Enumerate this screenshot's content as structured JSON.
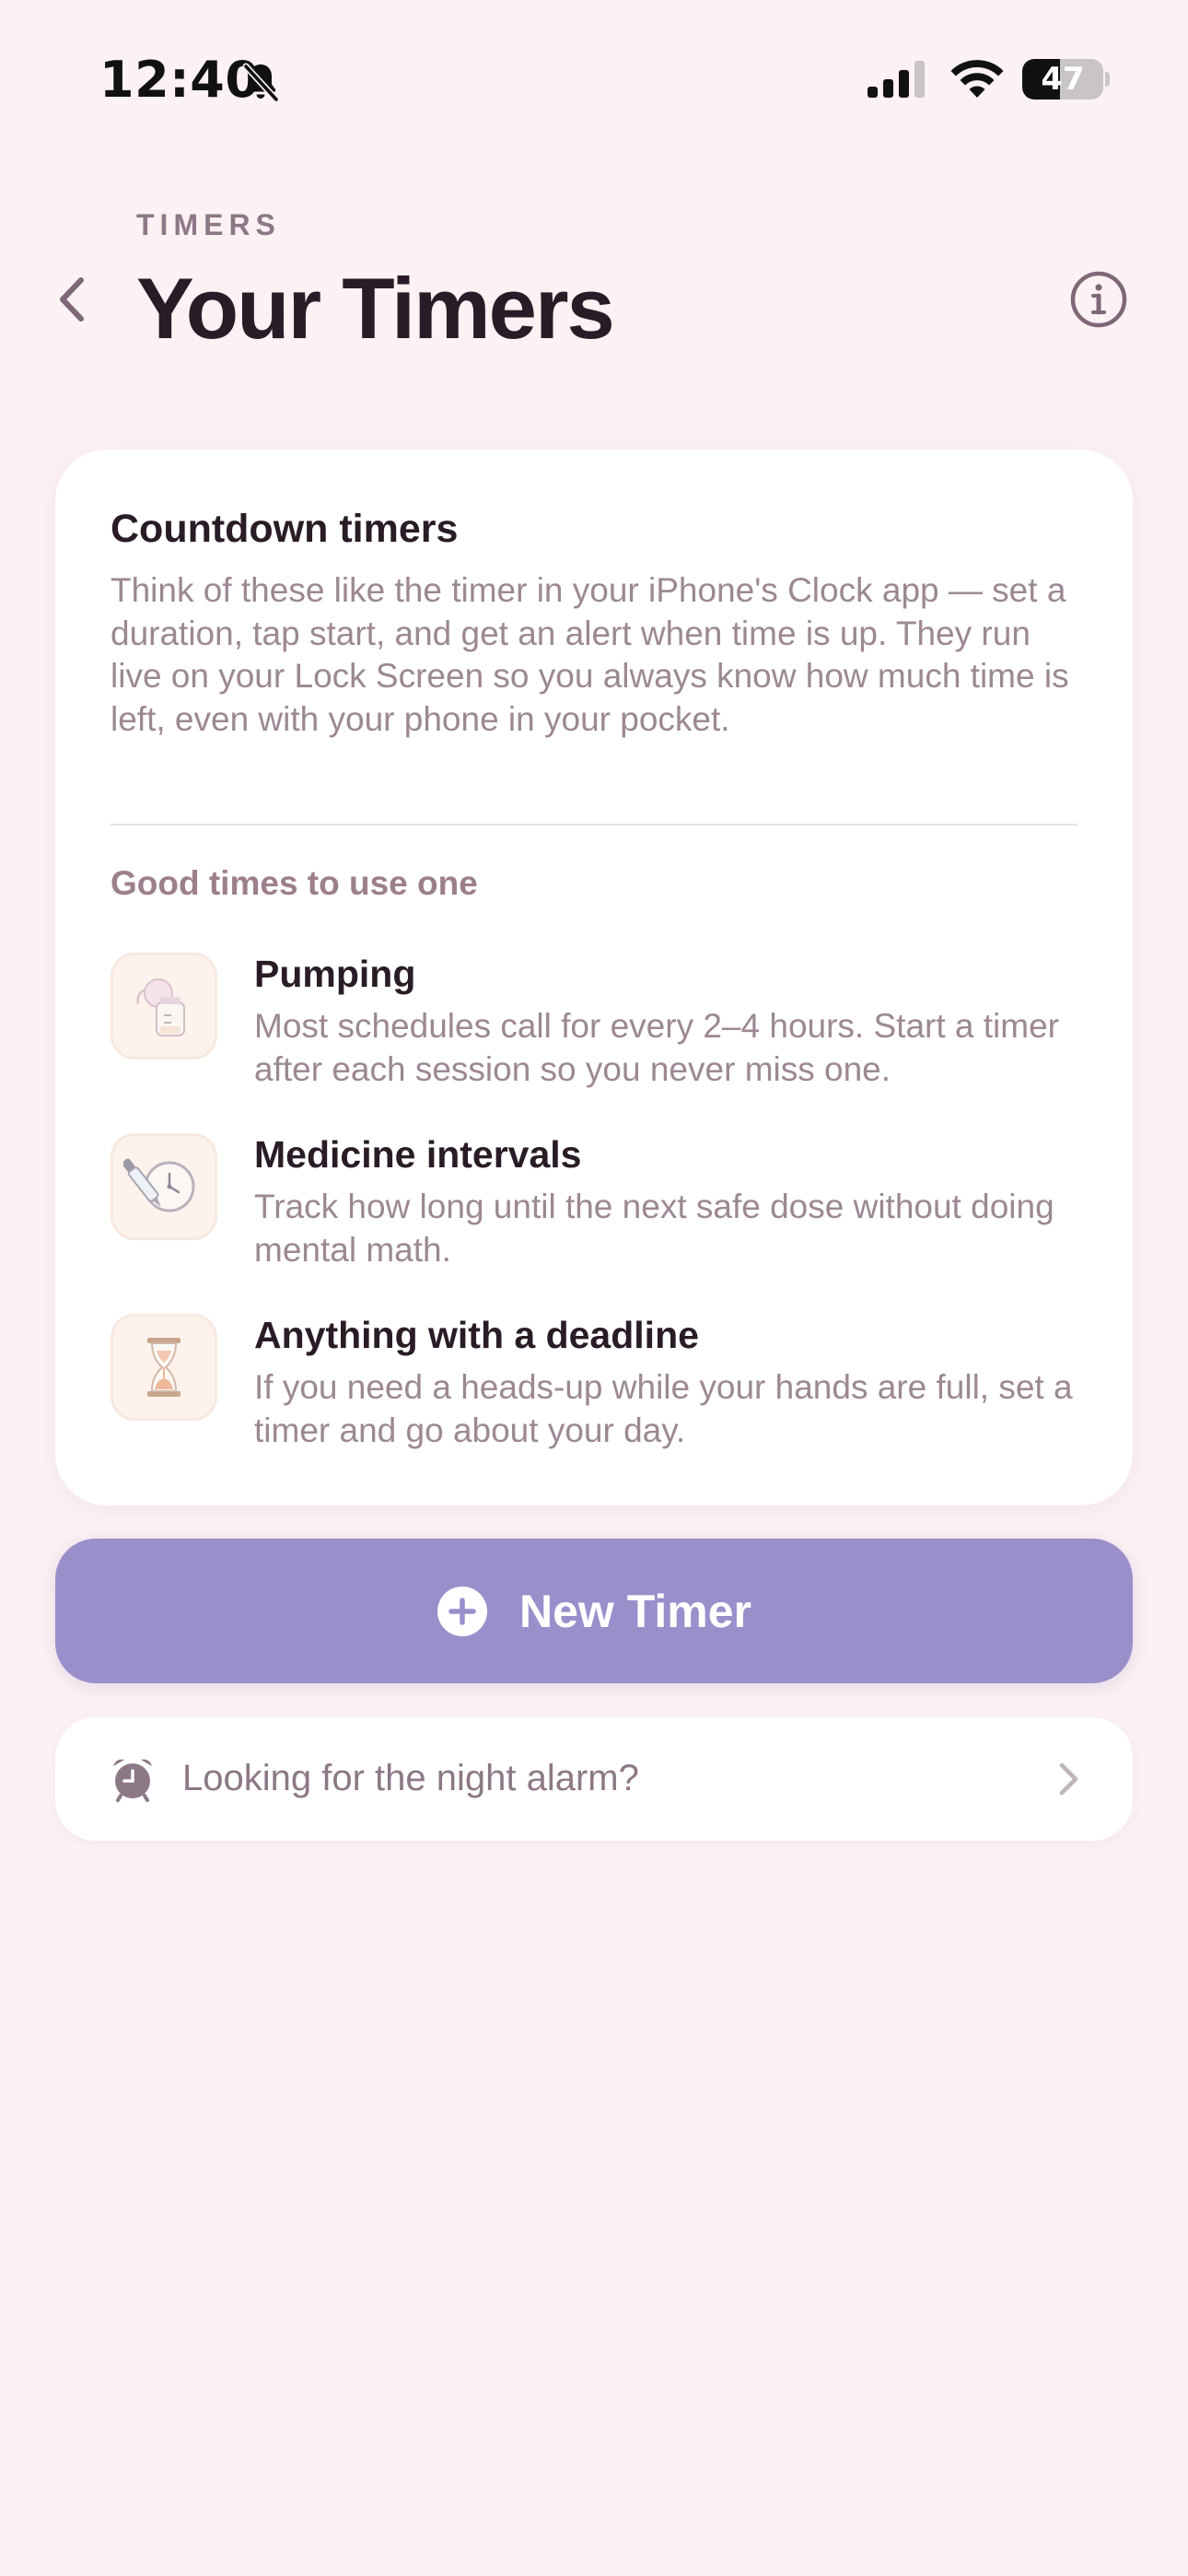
{
  "status_bar": {
    "time": "12:40",
    "battery_level": "47",
    "battery_fraction": 0.47,
    "icons": [
      "bell-slash-icon",
      "cellular-signal-icon",
      "wifi-icon",
      "battery-icon"
    ]
  },
  "header": {
    "eyebrow": "TIMERS",
    "title": "Your Timers",
    "back_icon": "chevron-left-icon",
    "info_icon": "info-icon"
  },
  "card": {
    "title": "Countdown timers",
    "description": "Think of these like the timer in your iPhone's Clock app — set a duration, tap start, and get an alert when time is up. They run live on your Lock Screen so you always know how much time is left, even with your phone in your pocket.",
    "section_label": "Good times to use one",
    "items": [
      {
        "icon": "breast-pump-icon",
        "title": "Pumping",
        "description": "Most schedules call for every 2–4 hours. Start a timer after each session so you never miss one."
      },
      {
        "icon": "medicine-dropper-clock-icon",
        "title": "Medicine intervals",
        "description": "Track how long until the next safe dose without doing mental math."
      },
      {
        "icon": "hourglass-icon",
        "title": "Anything with a deadline",
        "description": "If you need a heads-up while your hands are full, set a timer and go about your day."
      }
    ]
  },
  "new_timer_button": {
    "label": "New Timer",
    "icon": "plus-circle-icon"
  },
  "night_alarm_link": {
    "label": "Looking for the night alarm?",
    "icon": "alarm-clock-icon",
    "chevron": "chevron-right-icon"
  },
  "colors": {
    "background": "#fcf1f3",
    "card": "#ffffff",
    "accent": "#9a8fcb",
    "title_text": "#2a1c26",
    "muted_text": "#9c8893",
    "muted_label": "#8d7886",
    "icon_tile": "#fdf3ec"
  }
}
